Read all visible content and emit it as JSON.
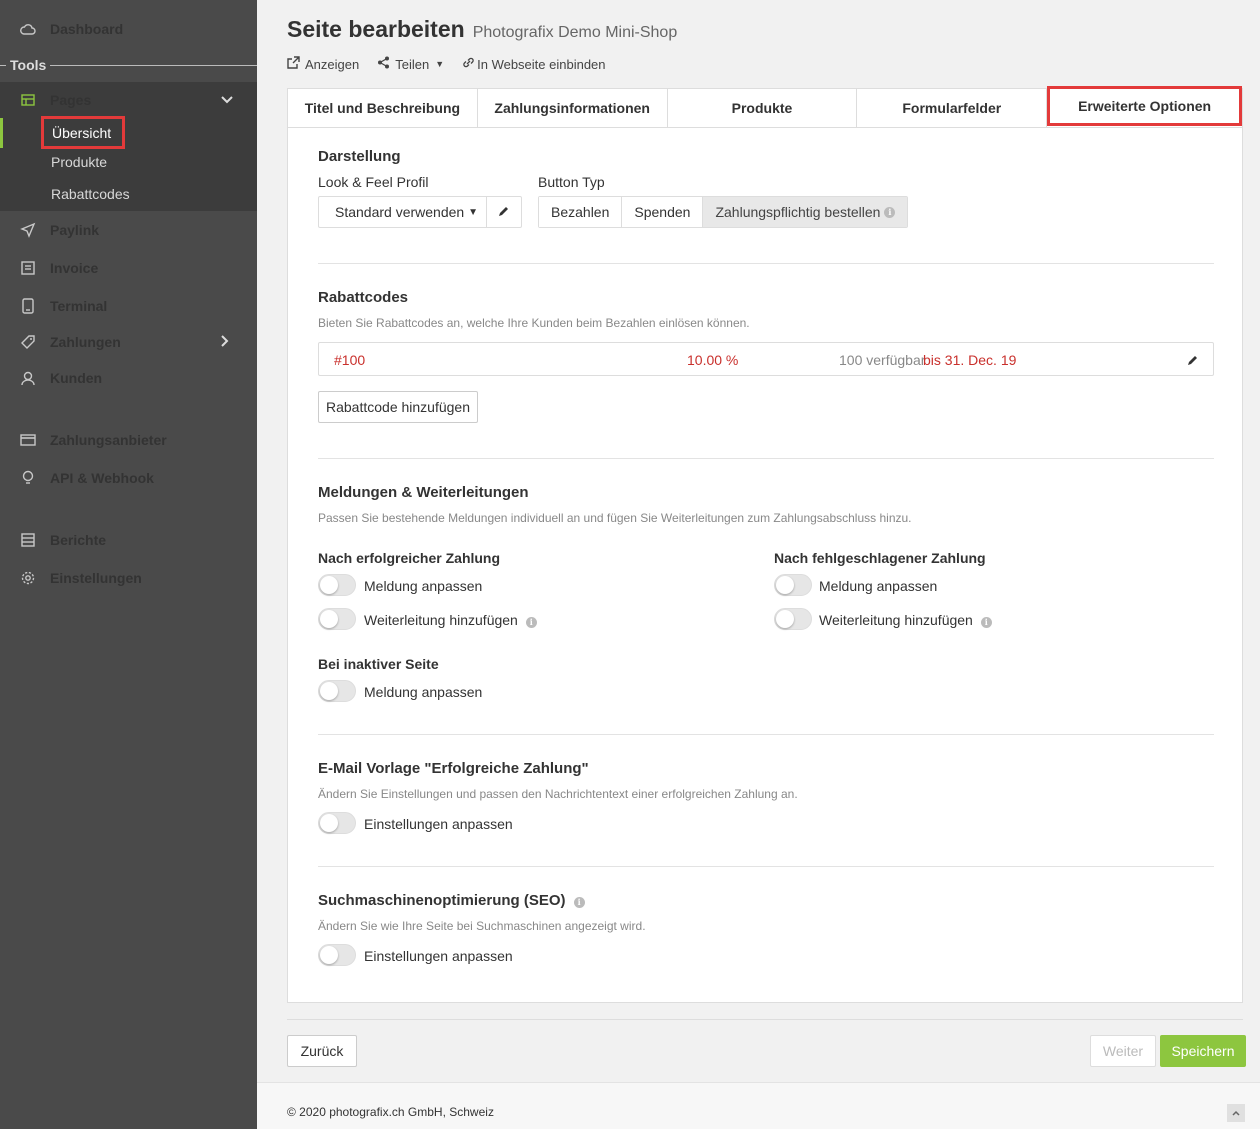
{
  "sidebar": {
    "dashboard": "Dashboard",
    "tools_heading": "Tools",
    "pages": "Pages",
    "pages_sub": [
      "Übersicht",
      "Produkte",
      "Rabattcodes"
    ],
    "paylink": "Paylink",
    "invoice": "Invoice",
    "terminal": "Terminal",
    "zahlungen": "Zahlungen",
    "kunden": "Kunden",
    "zahlungsanbieter": "Zahlungsanbieter",
    "api": "API & Webhook",
    "berichte": "Berichte",
    "einstellungen": "Einstellungen"
  },
  "header": {
    "title": "Seite bearbeiten",
    "subtitle": "Photografix Demo Mini-Shop",
    "actions": [
      "Anzeigen",
      "Teilen",
      "In Webseite einbinden"
    ]
  },
  "tabs": [
    "Titel und Beschreibung",
    "Zahlungsinformationen",
    "Produkte",
    "Formularfelder",
    "Erweiterte Optionen"
  ],
  "darstellung": {
    "title": "Darstellung",
    "look_label": "Look & Feel Profil",
    "look_value": "Standard verwenden",
    "button_label": "Button Typ",
    "button_options": [
      "Bezahlen",
      "Spenden",
      "Zahlungspflichtig bestellen"
    ],
    "button_selected": "Zahlungspflichtig bestellen"
  },
  "rabattcodes": {
    "title": "Rabattcodes",
    "desc": "Bieten Sie Rabattcodes an, welche Ihre Kunden beim Bezahlen einlösen können.",
    "code": "#100",
    "percent": "10.00 %",
    "available": "100 verfügbar",
    "until": "bis 31. Dec. 19",
    "add_button": "Rabattcode hinzufügen"
  },
  "meldungen": {
    "title": "Meldungen & Weiterleitungen",
    "desc": "Passen Sie bestehende Meldungen individuell an und fügen Sie Weiterleitungen zum Zahlungsabschluss hinzu.",
    "success_heading": "Nach erfolgreicher Zahlung",
    "fail_heading": "Nach fehlgeschlagener Zahlung",
    "inactive_heading": "Bei inaktiver Seite",
    "toggle_message": "Meldung anpassen",
    "toggle_redirect": "Weiterleitung hinzufügen"
  },
  "email": {
    "title": "E-Mail Vorlage \"Erfolgreiche Zahlung\"",
    "desc": "Ändern Sie Einstellungen und passen den Nachrichtentext einer erfolgreichen Zahlung an.",
    "toggle": "Einstellungen anpassen"
  },
  "seo": {
    "title": "Suchmaschinenoptimierung (SEO)",
    "desc": "Ändern Sie wie Ihre Seite bei Suchmaschinen angezeigt wird.",
    "toggle": "Einstellungen anpassen"
  },
  "footer": {
    "back": "Zurück",
    "next": "Weiter",
    "save": "Speichern",
    "copyright": "© 2020 photografix.ch GmbH, Schweiz"
  },
  "colors": {
    "accent": "#8dc63f",
    "highlight": "#e33a3a",
    "discount_red": "#c9302c"
  }
}
